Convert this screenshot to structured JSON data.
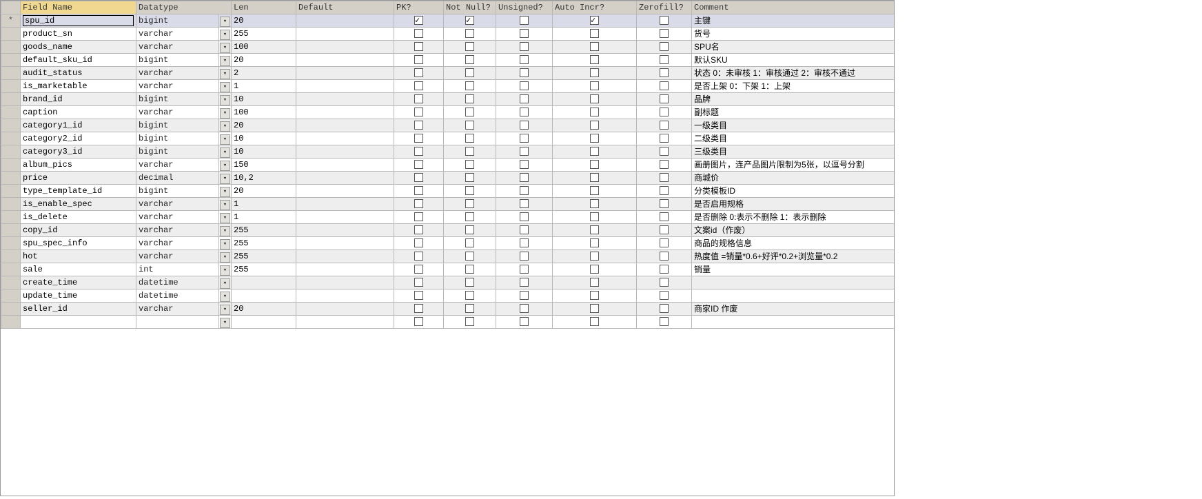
{
  "headers": {
    "field_name": "Field Name",
    "datatype": "Datatype",
    "len": "Len",
    "default": "Default",
    "pk": "PK?",
    "not_null": "Not Null?",
    "unsigned": "Unsigned?",
    "auto_incr": "Auto Incr?",
    "zerofill": "Zerofill?",
    "comment": "Comment"
  },
  "selected_marker": "*",
  "rows": [
    {
      "field": "spu_id",
      "datatype": "bigint",
      "len": "20",
      "default": "",
      "pk": true,
      "nn": true,
      "uns": false,
      "ai": true,
      "zf": false,
      "comment": "主键",
      "selected": true
    },
    {
      "field": "product_sn",
      "datatype": "varchar",
      "len": "255",
      "default": "",
      "pk": false,
      "nn": false,
      "uns": false,
      "ai": false,
      "zf": false,
      "comment": "货号"
    },
    {
      "field": "goods_name",
      "datatype": "varchar",
      "len": "100",
      "default": "",
      "pk": false,
      "nn": false,
      "uns": false,
      "ai": false,
      "zf": false,
      "comment": "SPU名"
    },
    {
      "field": "default_sku_id",
      "datatype": "bigint",
      "len": "20",
      "default": "",
      "pk": false,
      "nn": false,
      "uns": false,
      "ai": false,
      "zf": false,
      "comment": "默认SKU"
    },
    {
      "field": "audit_status",
      "datatype": "varchar",
      "len": "2",
      "default": "",
      "pk": false,
      "nn": false,
      "uns": false,
      "ai": false,
      "zf": false,
      "comment": "状态 0：未审核 1：审核通过 2：审核不通过"
    },
    {
      "field": "is_marketable",
      "datatype": "varchar",
      "len": "1",
      "default": "",
      "pk": false,
      "nn": false,
      "uns": false,
      "ai": false,
      "zf": false,
      "comment": "是否上架 0：下架 1：上架"
    },
    {
      "field": "brand_id",
      "datatype": "bigint",
      "len": "10",
      "default": "",
      "pk": false,
      "nn": false,
      "uns": false,
      "ai": false,
      "zf": false,
      "comment": "品牌"
    },
    {
      "field": "caption",
      "datatype": "varchar",
      "len": "100",
      "default": "",
      "pk": false,
      "nn": false,
      "uns": false,
      "ai": false,
      "zf": false,
      "comment": "副标题"
    },
    {
      "field": "category1_id",
      "datatype": "bigint",
      "len": "20",
      "default": "",
      "pk": false,
      "nn": false,
      "uns": false,
      "ai": false,
      "zf": false,
      "comment": "一级类目"
    },
    {
      "field": "category2_id",
      "datatype": "bigint",
      "len": "10",
      "default": "",
      "pk": false,
      "nn": false,
      "uns": false,
      "ai": false,
      "zf": false,
      "comment": "二级类目"
    },
    {
      "field": "category3_id",
      "datatype": "bigint",
      "len": "10",
      "default": "",
      "pk": false,
      "nn": false,
      "uns": false,
      "ai": false,
      "zf": false,
      "comment": "三级类目"
    },
    {
      "field": "album_pics",
      "datatype": "varchar",
      "len": "150",
      "default": "",
      "pk": false,
      "nn": false,
      "uns": false,
      "ai": false,
      "zf": false,
      "comment": "画册图片，连产品图片限制为5张，以逗号分割"
    },
    {
      "field": "price",
      "datatype": "decimal",
      "len": "10,2",
      "default": "",
      "pk": false,
      "nn": false,
      "uns": false,
      "ai": false,
      "zf": false,
      "comment": "商城价"
    },
    {
      "field": "type_template_id",
      "datatype": "bigint",
      "len": "20",
      "default": "",
      "pk": false,
      "nn": false,
      "uns": false,
      "ai": false,
      "zf": false,
      "comment": "分类模板ID"
    },
    {
      "field": "is_enable_spec",
      "datatype": "varchar",
      "len": "1",
      "default": "",
      "pk": false,
      "nn": false,
      "uns": false,
      "ai": false,
      "zf": false,
      "comment": "是否启用规格"
    },
    {
      "field": "is_delete",
      "datatype": "varchar",
      "len": "1",
      "default": "",
      "pk": false,
      "nn": false,
      "uns": false,
      "ai": false,
      "zf": false,
      "comment": "是否删除 0:表示不删除  1：表示删除"
    },
    {
      "field": "copy_id",
      "datatype": "varchar",
      "len": "255",
      "default": "",
      "pk": false,
      "nn": false,
      "uns": false,
      "ai": false,
      "zf": false,
      "comment": "文案id（作废）"
    },
    {
      "field": "spu_spec_info",
      "datatype": "varchar",
      "len": "255",
      "default": "",
      "pk": false,
      "nn": false,
      "uns": false,
      "ai": false,
      "zf": false,
      "comment": "商品的规格信息"
    },
    {
      "field": "hot",
      "datatype": "varchar",
      "len": "255",
      "default": "",
      "pk": false,
      "nn": false,
      "uns": false,
      "ai": false,
      "zf": false,
      "comment": "热度值  =销量*0.6+好评*0.2+浏览量*0.2"
    },
    {
      "field": "sale",
      "datatype": "int",
      "len": "255",
      "default": "",
      "pk": false,
      "nn": false,
      "uns": false,
      "ai": false,
      "zf": false,
      "comment": "销量"
    },
    {
      "field": "create_time",
      "datatype": "datetime",
      "len": "",
      "default": "",
      "pk": false,
      "nn": false,
      "uns": false,
      "ai": false,
      "zf": false,
      "comment": ""
    },
    {
      "field": "update_time",
      "datatype": "datetime",
      "len": "",
      "default": "",
      "pk": false,
      "nn": false,
      "uns": false,
      "ai": false,
      "zf": false,
      "comment": ""
    },
    {
      "field": "seller_id",
      "datatype": "varchar",
      "len": "20",
      "default": "",
      "pk": false,
      "nn": false,
      "uns": false,
      "ai": false,
      "zf": false,
      "comment": "商家ID  作废"
    },
    {
      "field": "",
      "datatype": "",
      "len": "",
      "default": "",
      "pk": false,
      "nn": false,
      "uns": false,
      "ai": false,
      "zf": false,
      "comment": ""
    }
  ]
}
